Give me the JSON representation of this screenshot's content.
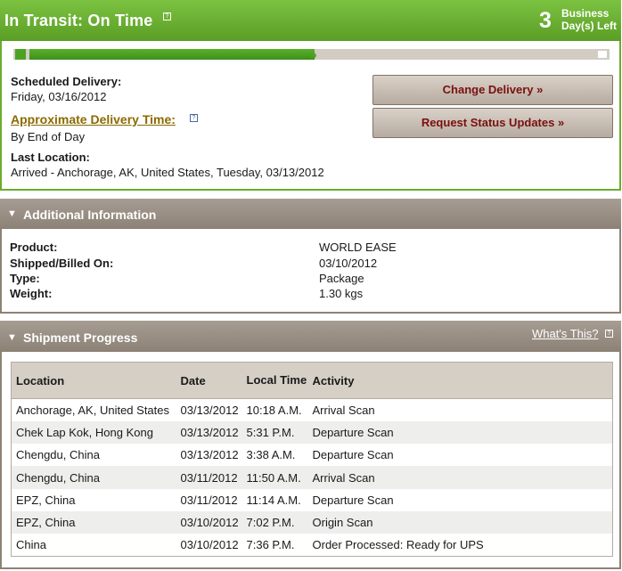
{
  "status": {
    "title": "In Transit: On Time",
    "days_count": "3",
    "days_label_line1": "Business",
    "days_label_line2": "Day(s) Left",
    "progress_fraction": 0.5
  },
  "delivery": {
    "scheduled_label": "Scheduled Delivery:",
    "scheduled_value": "Friday, 03/16/2012",
    "approx_label": "Approximate Delivery Time:",
    "approx_value": "By End of Day",
    "last_location_label": "Last Location:",
    "last_location_value": "Arrived - Anchorage, AK, United States, Tuesday, 03/13/2012"
  },
  "buttons": {
    "change_delivery": "Change Delivery »",
    "request_updates": "Request Status Updates »"
  },
  "additional_info": {
    "title": "Additional Information",
    "rows": [
      {
        "label": "Product:",
        "value": "WORLD EASE"
      },
      {
        "label": "Shipped/Billed On:",
        "value": "03/10/2012"
      },
      {
        "label": "Type:",
        "value": "Package"
      },
      {
        "label": "Weight:",
        "value": "1.30 kgs"
      }
    ]
  },
  "shipment_progress": {
    "title": "Shipment Progress",
    "whats_this": "What's This?",
    "columns": [
      "Location",
      "Date",
      "Local Time",
      "Activity"
    ],
    "rows": [
      [
        "Anchorage, AK, United States",
        "03/13/2012",
        "10:18 A.M.",
        "Arrival Scan"
      ],
      [
        "Chek Lap Kok, Hong Kong",
        "03/13/2012",
        "5:31 P.M.",
        "Departure Scan"
      ],
      [
        "Chengdu, China",
        "03/13/2012",
        "3:38 A.M.",
        "Departure Scan"
      ],
      [
        "Chengdu, China",
        "03/11/2012",
        "11:50 A.M.",
        "Arrival Scan"
      ],
      [
        "EPZ, China",
        "03/11/2012",
        "11:14 A.M.",
        "Departure Scan"
      ],
      [
        "EPZ, China",
        "03/10/2012",
        "7:02 P.M.",
        "Origin Scan"
      ],
      [
        "China",
        "03/10/2012",
        "7:36 P.M.",
        "Order Processed: Ready for UPS"
      ]
    ]
  },
  "colors": {
    "status_green": "#6aac2f",
    "section_brown": "#8d8275",
    "button_text": "#7a1010",
    "link_gold": "#8b6a00"
  }
}
